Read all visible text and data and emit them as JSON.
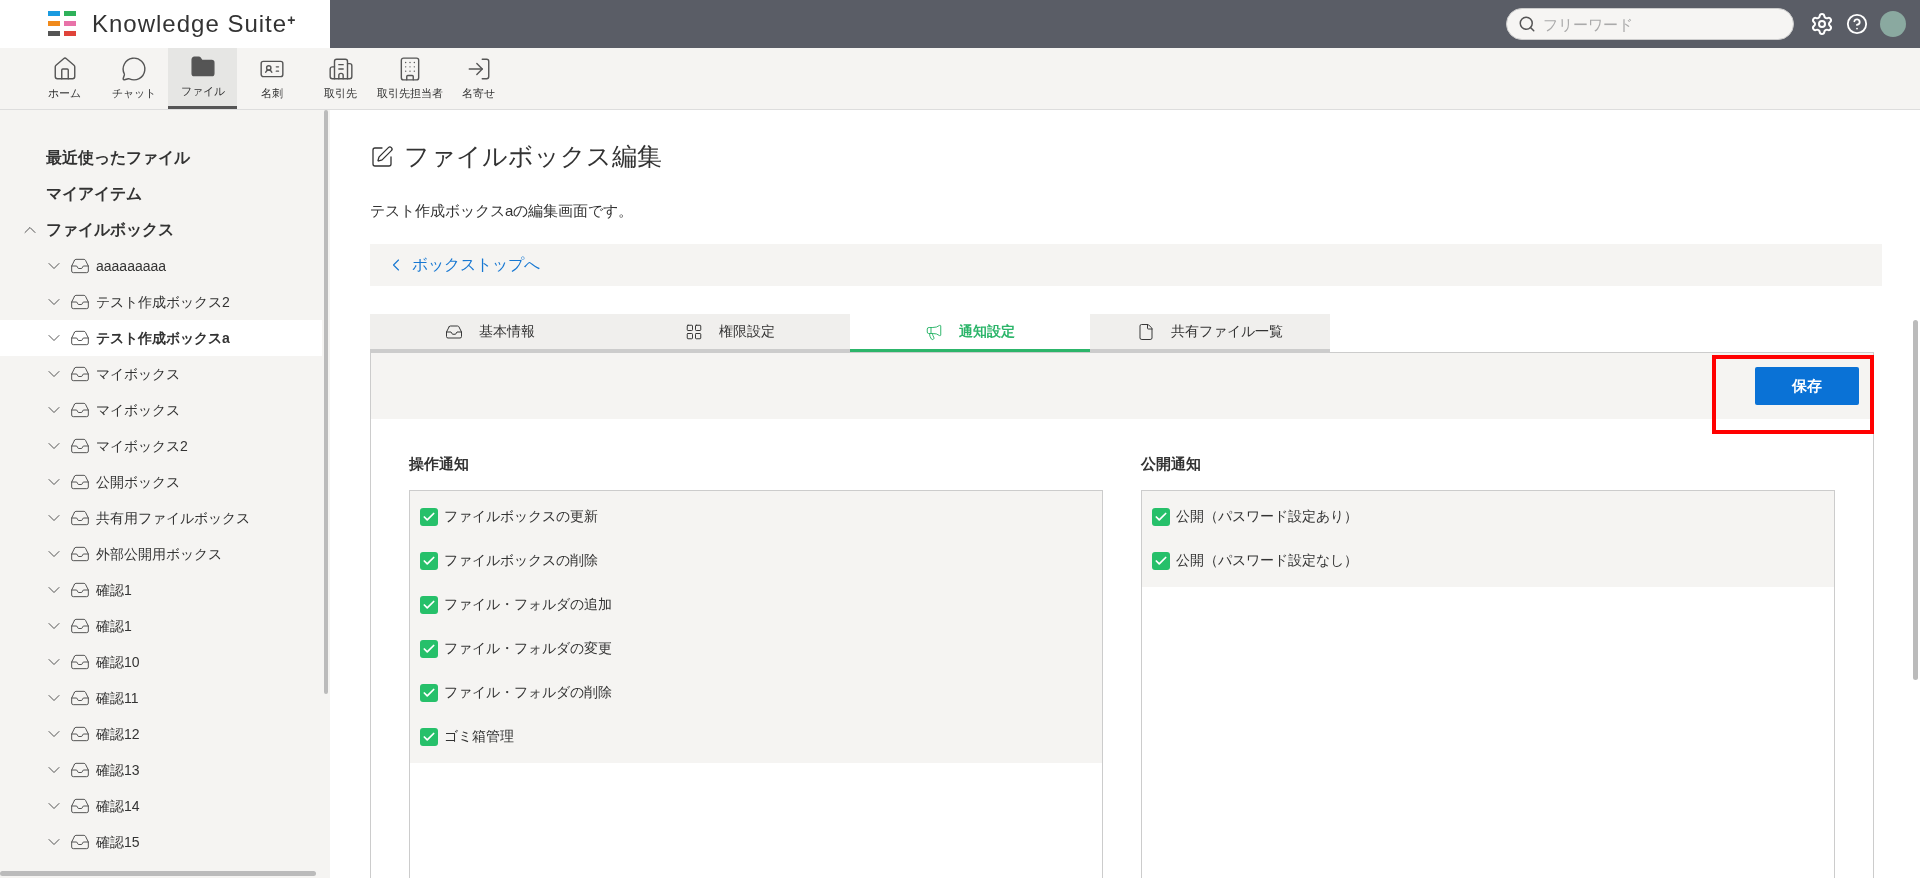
{
  "header": {
    "logo_text": "Knowledge Suite",
    "logo_sup": "+",
    "search": {
      "placeholder": "フリーワード"
    }
  },
  "nav": [
    {
      "label": "ホーム",
      "selected": false
    },
    {
      "label": "チャット",
      "selected": false
    },
    {
      "label": "ファイル",
      "selected": true
    },
    {
      "label": "名刺",
      "selected": false
    },
    {
      "label": "取引先",
      "selected": false
    },
    {
      "label": "取引先担当者",
      "selected": false
    },
    {
      "label": "名寄せ",
      "selected": false
    }
  ],
  "sidebar": {
    "items": [
      {
        "label": "最近使ったファイル",
        "kind": "link"
      },
      {
        "label": "マイアイテム",
        "kind": "link"
      },
      {
        "label": "ファイルボックス",
        "kind": "folder",
        "expanded": true,
        "children": [
          {
            "label": "aaaaaaaaa",
            "expanded": false,
            "selected": false
          },
          {
            "label": "テスト作成ボックス2",
            "expanded": false,
            "selected": false
          },
          {
            "label": "テスト作成ボックスa",
            "expanded": false,
            "selected": true
          },
          {
            "label": "マイボックス",
            "expanded": false,
            "selected": false
          },
          {
            "label": "マイボックス",
            "expanded": false,
            "selected": false
          },
          {
            "label": "マイボックス2",
            "expanded": false,
            "selected": false
          },
          {
            "label": "公開ボックス",
            "expanded": false,
            "selected": false
          },
          {
            "label": "共有用ファイルボックス",
            "expanded": false,
            "selected": false
          },
          {
            "label": "外部公開用ボックス",
            "expanded": false,
            "selected": false
          },
          {
            "label": "確認1",
            "expanded": false,
            "selected": false
          },
          {
            "label": "確認1",
            "expanded": false,
            "selected": false
          },
          {
            "label": "確認10",
            "expanded": false,
            "selected": false
          },
          {
            "label": "確認11",
            "expanded": false,
            "selected": false
          },
          {
            "label": "確認12",
            "expanded": false,
            "selected": false
          },
          {
            "label": "確認13",
            "expanded": false,
            "selected": false
          },
          {
            "label": "確認14",
            "expanded": false,
            "selected": false
          },
          {
            "label": "確認15",
            "expanded": false,
            "selected": false
          }
        ]
      }
    ]
  },
  "page": {
    "title": "ファイルボックス編集",
    "description": "テスト作成ボックスaの編集画面です。",
    "back_link": "ボックストップへ",
    "tabs": [
      {
        "label": "基本情報",
        "selected": false
      },
      {
        "label": "権限設定",
        "selected": false
      },
      {
        "label": "通知設定",
        "selected": true
      },
      {
        "label": "共有ファイル一覧",
        "selected": false
      }
    ],
    "save_button": "保存",
    "sections": [
      {
        "title": "操作通知",
        "options": [
          {
            "label": "ファイルボックスの更新",
            "checked": true
          },
          {
            "label": "ファイルボックスの削除",
            "checked": true
          },
          {
            "label": "ファイル・フォルダの追加",
            "checked": true
          },
          {
            "label": "ファイル・フォルダの変更",
            "checked": true
          },
          {
            "label": "ファイル・フォルダの削除",
            "checked": true
          },
          {
            "label": "ゴミ箱管理",
            "checked": true
          }
        ]
      },
      {
        "title": "公開通知",
        "options": [
          {
            "label": "公開（パスワード設定あり）",
            "checked": true
          },
          {
            "label": "公開（パスワード設定なし）",
            "checked": true
          }
        ]
      }
    ]
  }
}
